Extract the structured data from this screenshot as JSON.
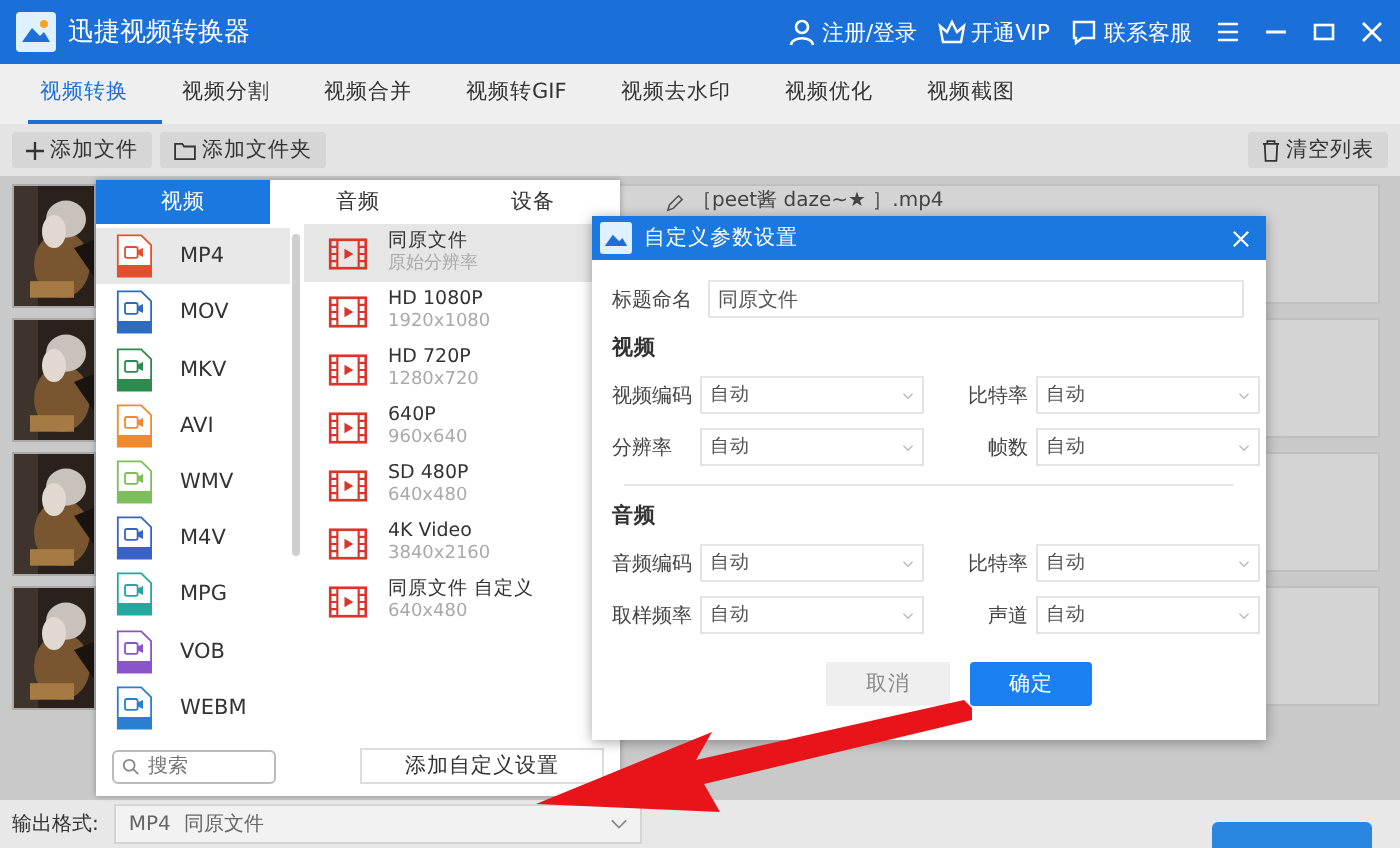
{
  "app": {
    "title": "迅捷视频转换器",
    "header_links": [
      {
        "kind": "user",
        "label": "注册/登录"
      },
      {
        "kind": "vip",
        "label": "开通VIP"
      },
      {
        "kind": "service",
        "label": "联系客服"
      }
    ]
  },
  "tabs": [
    {
      "label": "视频转换",
      "selected": true
    },
    {
      "label": "视频分割",
      "selected": false
    },
    {
      "label": "视频合并",
      "selected": false
    },
    {
      "label": "视频转GIF",
      "selected": false
    },
    {
      "label": "视频去水印",
      "selected": false
    },
    {
      "label": "视频优化",
      "selected": false
    },
    {
      "label": "视频截图",
      "selected": false
    }
  ],
  "toolbar": {
    "add_file": "添加文件",
    "add_folder": "添加文件夹",
    "clear_list": "清空列表"
  },
  "files": [
    {
      "thumbnail": {
        "kind": "picture"
      },
      "name": "［peet酱 daze~★ ］.mp4"
    },
    {
      "thumbnail": {
        "kind": "picture"
      }
    },
    {
      "thumbnail": {
        "kind": "picture"
      }
    },
    {
      "thumbnail": {
        "kind": "picture"
      }
    }
  ],
  "format_popup": {
    "tabs": [
      {
        "label": "视频",
        "selected": true
      },
      {
        "label": "音频",
        "selected": false
      },
      {
        "label": "设备",
        "selected": false
      }
    ],
    "formats": [
      {
        "label": "MP4",
        "color": "#e2512f",
        "selected": true
      },
      {
        "label": "MOV",
        "color": "#2d6bbf",
        "selected": false
      },
      {
        "label": "MKV",
        "color": "#2e8b4e",
        "selected": false
      },
      {
        "label": "AVI",
        "color": "#f08a2c",
        "selected": false
      },
      {
        "label": "WMV",
        "color": "#7cbf5a",
        "selected": false
      },
      {
        "label": "M4V",
        "color": "#3a63c8",
        "selected": false
      },
      {
        "label": "MPG",
        "color": "#23a8a0",
        "selected": false
      },
      {
        "label": "VOB",
        "color": "#8a55c8",
        "selected": false
      },
      {
        "label": "WEBM",
        "color": "#2a7fd0",
        "selected": false
      }
    ],
    "presets": [
      {
        "title": "同原文件",
        "resolution": "原始分辨率",
        "selected": true
      },
      {
        "title": "HD 1080P",
        "resolution": "1920x1080",
        "selected": false
      },
      {
        "title": "HD 720P",
        "resolution": "1280x720",
        "selected": false
      },
      {
        "title": "640P",
        "resolution": "960x640",
        "selected": false
      },
      {
        "title": "SD 480P",
        "resolution": "640x480",
        "selected": false
      },
      {
        "title": "4K Video",
        "resolution": "3840x2160",
        "selected": false
      },
      {
        "title": "同原文件 自定义",
        "resolution": "640x480",
        "selected": false
      }
    ],
    "search": {
      "placeholder": "搜索"
    },
    "add_custom_button": "添加自定义设置"
  },
  "dialog": {
    "title": "自定义参数设置",
    "name_label": "标题命名",
    "name_value": "同原文件",
    "sections": [
      {
        "heading": "视频",
        "fields": [
          {
            "label": "视频编码",
            "value": "自动"
          },
          {
            "label": "比特率",
            "value": "自动"
          },
          {
            "label": "分辨率",
            "value": "自动"
          },
          {
            "label": "帧数",
            "value": "自动"
          }
        ]
      },
      {
        "heading": "音频",
        "fields": [
          {
            "label": "音频编码",
            "value": "自动"
          },
          {
            "label": "比特率",
            "value": "自动"
          },
          {
            "label": "取样频率",
            "value": "自动"
          },
          {
            "label": "声道",
            "value": "自动"
          }
        ]
      }
    ],
    "cancel": "取消",
    "ok": "确定"
  },
  "bottom_bar": {
    "output_label": "输出格式:",
    "output_value": "MP4  同原文件"
  }
}
